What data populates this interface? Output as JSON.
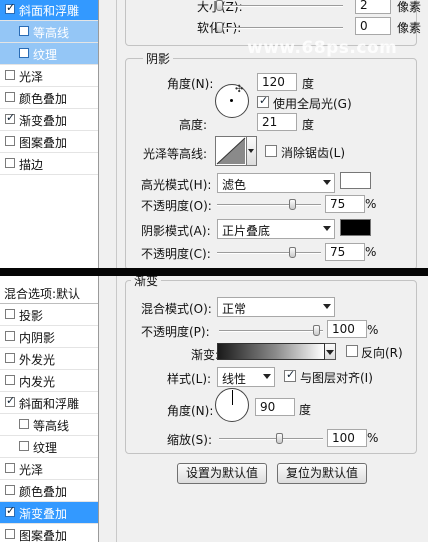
{
  "top": {
    "sidebar": [
      {
        "label": "斜面和浮雕",
        "checked": true,
        "sub": false,
        "state": "sel"
      },
      {
        "label": "等高线",
        "checked": false,
        "sub": true,
        "state": "sel2"
      },
      {
        "label": "纹理",
        "checked": false,
        "sub": true,
        "state": "sel2"
      },
      {
        "label": "光泽",
        "checked": false,
        "sub": false,
        "state": ""
      },
      {
        "label": "颜色叠加",
        "checked": false,
        "sub": false,
        "state": ""
      },
      {
        "label": "渐变叠加",
        "checked": true,
        "sub": false,
        "state": ""
      },
      {
        "label": "图案叠加",
        "checked": false,
        "sub": false,
        "state": ""
      },
      {
        "label": "描边",
        "checked": false,
        "sub": false,
        "state": ""
      }
    ],
    "size_label": "大小(Z):",
    "size_value": "2",
    "size_unit": "像素",
    "soften_label": "软化(F):",
    "soften_value": "0",
    "soften_unit": "像素",
    "watermark": "www.68ps.com",
    "shading_title": "阴影",
    "angle_label": "角度(N):",
    "angle_value": "120",
    "angle_unit": "度",
    "global_light_label": "使用全局光(G)",
    "global_light_checked": true,
    "altitude_label": "高度:",
    "altitude_value": "21",
    "altitude_unit": "度",
    "gloss_label": "光泽等高线:",
    "antialias_label": "消除锯齿(L)",
    "highlight_mode_label": "高光模式(H):",
    "highlight_mode_value": "滤色",
    "highlight_color": "#ffffff",
    "highlight_opacity_label": "不透明度(O):",
    "highlight_opacity_value": "75",
    "percent": "%",
    "shadow_mode_label": "阴影模式(A):",
    "shadow_mode_value": "正片叠底",
    "shadow_color": "#000000",
    "shadow_opacity_label": "不透明度(C):",
    "shadow_opacity_value": "75"
  },
  "bottom": {
    "sidebar": [
      {
        "label": "混合选项:默认",
        "title": true
      },
      {
        "label": "投影",
        "checked": false,
        "sub": false,
        "state": ""
      },
      {
        "label": "内阴影",
        "checked": false,
        "sub": false,
        "state": ""
      },
      {
        "label": "外发光",
        "checked": false,
        "sub": false,
        "state": ""
      },
      {
        "label": "内发光",
        "checked": false,
        "sub": false,
        "state": ""
      },
      {
        "label": "斜面和浮雕",
        "checked": true,
        "sub": false,
        "state": ""
      },
      {
        "label": "等高线",
        "checked": false,
        "sub": true,
        "state": ""
      },
      {
        "label": "纹理",
        "checked": false,
        "sub": true,
        "state": ""
      },
      {
        "label": "光泽",
        "checked": false,
        "sub": false,
        "state": ""
      },
      {
        "label": "颜色叠加",
        "checked": false,
        "sub": false,
        "state": ""
      },
      {
        "label": "渐变叠加",
        "checked": true,
        "sub": false,
        "state": "sel"
      },
      {
        "label": "图案叠加",
        "checked": false,
        "sub": false,
        "state": ""
      }
    ],
    "group_title": "渐变",
    "blend_mode_label": "混合模式(O):",
    "blend_mode_value": "正常",
    "opacity_label": "不透明度(P):",
    "opacity_value": "100",
    "percent": "%",
    "gradient_label": "渐变:",
    "reverse_label": "反向(R)",
    "reverse_checked": false,
    "style_label": "样式(L):",
    "style_value": "线性",
    "align_label": "与图层对齐(I)",
    "align_checked": true,
    "angle_label": "角度(N):",
    "angle_value": "90",
    "angle_unit": "度",
    "scale_label": "缩放(S):",
    "scale_value": "100",
    "make_default_label": "设置为默认值",
    "reset_default_label": "复位为默认值"
  }
}
